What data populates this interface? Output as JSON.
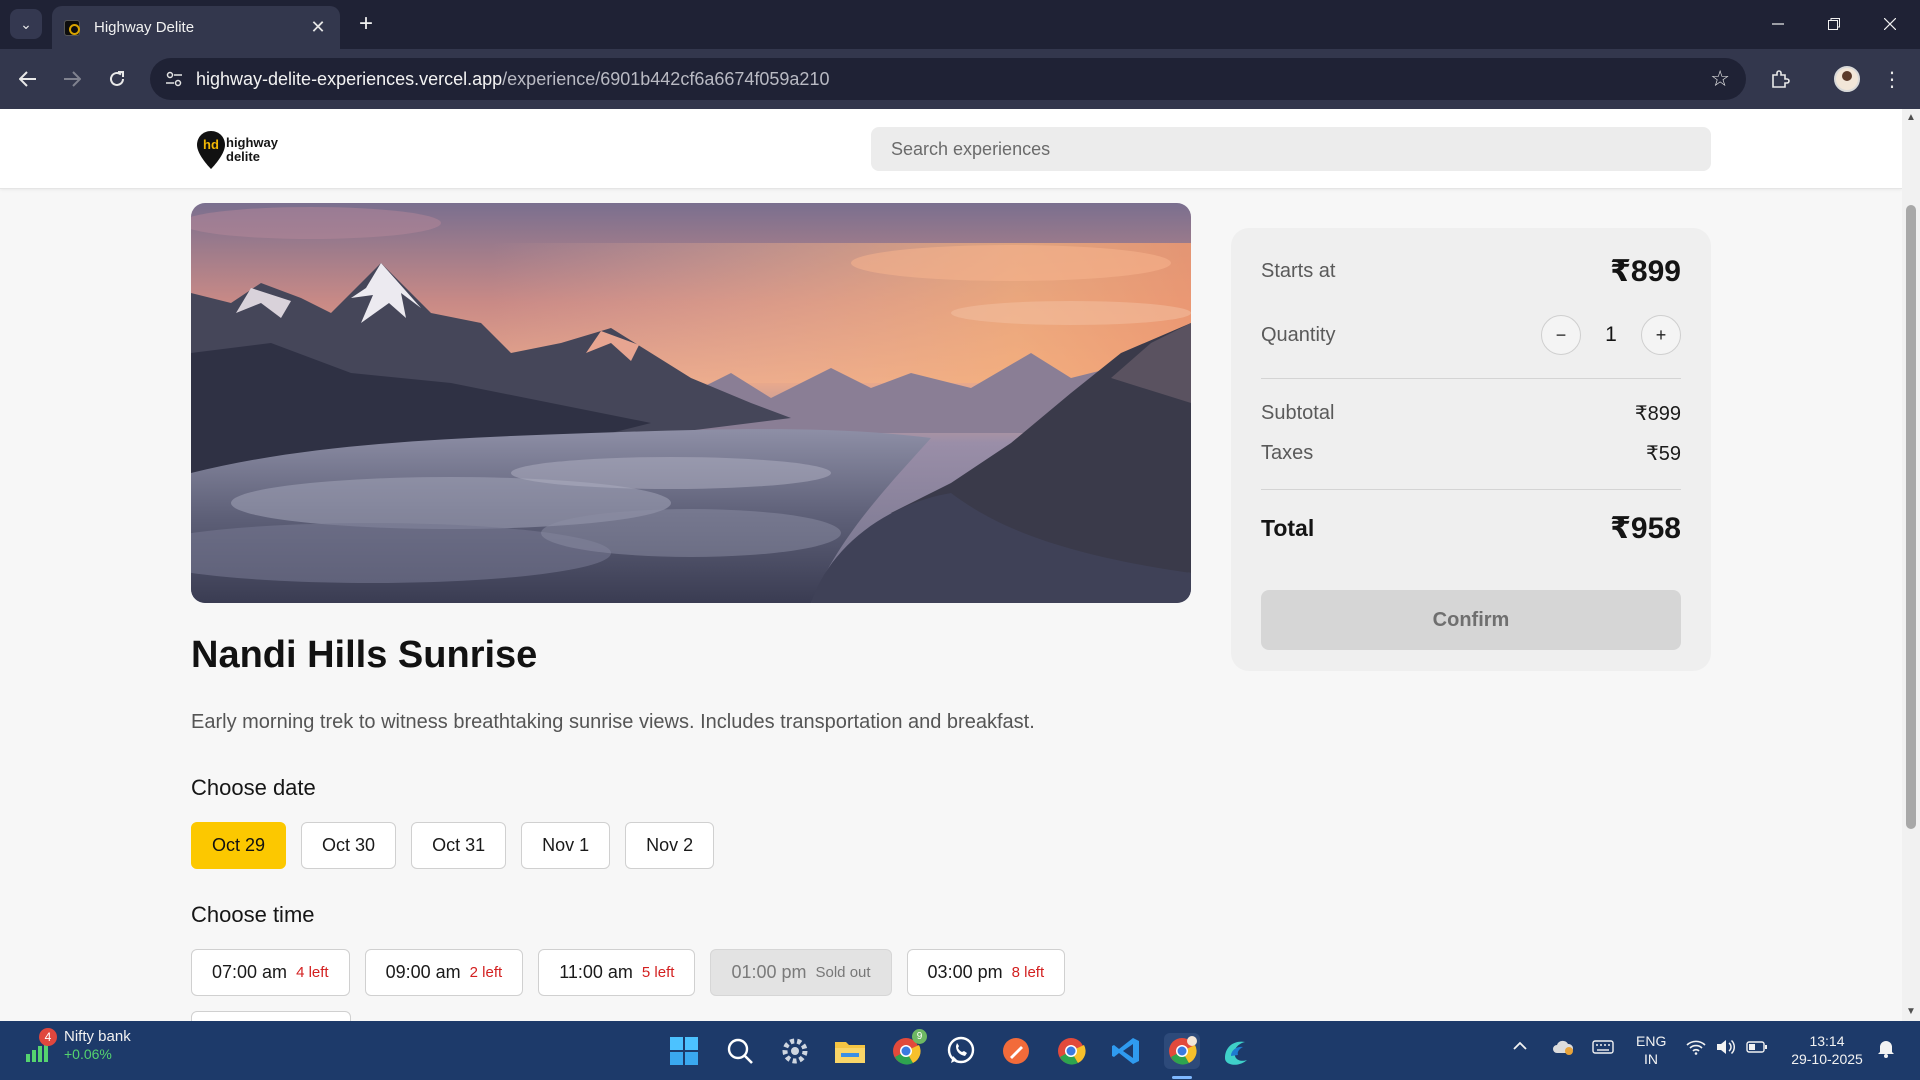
{
  "browser": {
    "tab_title": "Highway Delite",
    "url_host": "highway-delite-experiences.vercel.app",
    "url_path": "/experience/6901b442cf6a6674f059a210"
  },
  "header": {
    "logo_line1": "highway",
    "logo_line2": "delite",
    "search_placeholder": "Search experiences"
  },
  "experience": {
    "title": "Nandi Hills Sunrise",
    "description": "Early morning trek to witness breathtaking sunrise views. Includes transportation and breakfast.",
    "choose_date_label": "Choose date",
    "dates": [
      {
        "label": "Oct 29",
        "selected": true
      },
      {
        "label": "Oct 30",
        "selected": false
      },
      {
        "label": "Oct 31",
        "selected": false
      },
      {
        "label": "Nov 1",
        "selected": false
      },
      {
        "label": "Nov 2",
        "selected": false
      }
    ],
    "choose_time_label": "Choose time",
    "times": [
      {
        "time": "07:00 am",
        "availability": "4 left",
        "sold_out": false
      },
      {
        "time": "09:00 am",
        "availability": "2 left",
        "sold_out": false
      },
      {
        "time": "11:00 am",
        "availability": "5 left",
        "sold_out": false
      },
      {
        "time": "01:00 pm",
        "availability": "Sold out",
        "sold_out": true
      },
      {
        "time": "03:00 pm",
        "availability": "8 left",
        "sold_out": false
      }
    ]
  },
  "summary": {
    "starts_at_label": "Starts at",
    "starts_at_value": "₹899",
    "quantity_label": "Quantity",
    "quantity_value": "1",
    "minus_symbol": "−",
    "plus_symbol": "+",
    "subtotal_label": "Subtotal",
    "subtotal_value": "₹899",
    "taxes_label": "Taxes",
    "taxes_value": "₹59",
    "total_label": "Total",
    "total_value": "₹958",
    "confirm_label": "Confirm"
  },
  "taskbar": {
    "widget_badge": "4",
    "widget_title": "Nifty bank",
    "widget_change": "+0.06%",
    "chrome_badge": "9",
    "lang_line1": "ENG",
    "lang_line2": "IN",
    "time": "13:14",
    "date": "29-10-2025"
  },
  "colors": {
    "accent_yellow": "#fcc800",
    "availability_red": "#d32020",
    "taskbar": "#1d3a6a",
    "browser_frame": "#1f2235"
  }
}
